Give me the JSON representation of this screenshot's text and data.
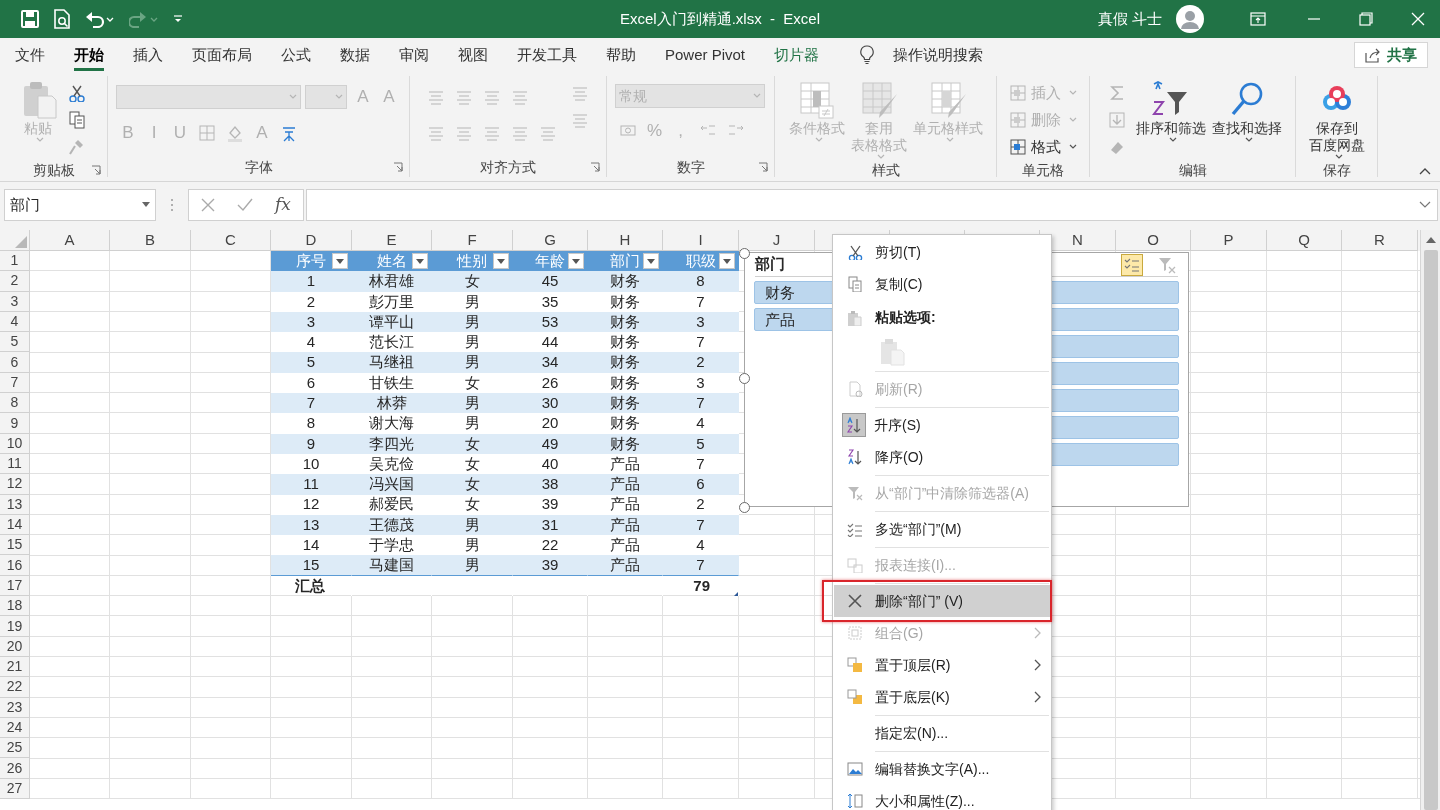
{
  "title_bar": {
    "title": "Excel入门到精通.xlsx  -  Excel",
    "user": "真假 斗士"
  },
  "tabs": [
    {
      "label": "文件",
      "selected": false
    },
    {
      "label": "开始",
      "selected": true
    },
    {
      "label": "插入",
      "selected": false
    },
    {
      "label": "页面布局",
      "selected": false
    },
    {
      "label": "公式",
      "selected": false
    },
    {
      "label": "数据",
      "selected": false
    },
    {
      "label": "审阅",
      "selected": false
    },
    {
      "label": "视图",
      "selected": false
    },
    {
      "label": "开发工具",
      "selected": false
    },
    {
      "label": "帮助",
      "selected": false
    },
    {
      "label": "Power Pivot",
      "selected": false
    }
  ],
  "contextual_tab": {
    "label": "切片器",
    "selected": false
  },
  "tell_me": {
    "placeholder": "操作说明搜索"
  },
  "share_button": {
    "label": "共享"
  },
  "ribbon": [
    {
      "label": "剪贴板",
      "launcher": true,
      "items": [
        {
          "kind": "large",
          "label": "粘贴",
          "disabled": true
        },
        {
          "kind": "stack",
          "items": [
            {
              "kind": "icon",
              "disabled": false
            },
            {
              "kind": "icon",
              "disabled": false
            },
            {
              "kind": "icon",
              "disabled": true
            }
          ]
        }
      ]
    },
    {
      "label": "字体",
      "launcher": true,
      "items": [
        {
          "kind": "grid",
          "rows": [
            [
              {
                "kind": "combo",
                "disabled": true
              },
              {
                "kind": "combo_small",
                "disabled": true
              },
              {
                "kind": "char",
                "label": "A",
                "disabled": true
              },
              {
                "kind": "char",
                "label": "A",
                "disabled": true
              }
            ],
            [
              {
                "kind": "char",
                "label": "B",
                "disabled": true
              },
              {
                "kind": "char",
                "label": "I",
                "disabled": true
              },
              {
                "kind": "char",
                "label": "U",
                "disabled": true
              },
              {
                "kind": "icon",
                "disabled": true
              },
              {
                "kind": "icon",
                "disabled": true
              },
              {
                "kind": "char",
                "label": "A",
                "disabled": true
              },
              {
                "kind": "icon",
                "disabled": false
              }
            ]
          ]
        }
      ]
    },
    {
      "label": "对齐方式",
      "launcher": true,
      "items": [
        {
          "kind": "grid",
          "rows": [
            [
              {
                "kind": "icon",
                "disabled": true
              },
              {
                "kind": "icon",
                "disabled": true
              },
              {
                "kind": "icon",
                "disabled": true
              },
              {
                "kind": "icon",
                "disabled": true
              }
            ],
            [
              {
                "kind": "icon",
                "disabled": true
              },
              {
                "kind": "icon",
                "disabled": true
              },
              {
                "kind": "icon",
                "disabled": true
              },
              {
                "kind": "icon",
                "disabled": true
              },
              {
                "kind": "icon",
                "disabled": true
              }
            ]
          ]
        },
        {
          "kind": "stack",
          "items": [
            {
              "kind": "icon",
              "disabled": true
            },
            {
              "kind": "icon",
              "disabled": true
            }
          ]
        }
      ]
    },
    {
      "label": "数字",
      "launcher": true,
      "items": [
        {
          "kind": "grid",
          "rows": [
            [
              {
                "kind": "combo",
                "value": "常规",
                "disabled": true
              }
            ],
            [
              {
                "kind": "icon",
                "disabled": true
              },
              {
                "kind": "char",
                "label": "%",
                "disabled": true
              },
              {
                "kind": "char",
                "label": ",",
                "disabled": true
              },
              {
                "kind": "icon",
                "disabled": true
              },
              {
                "kind": "icon",
                "disabled": true
              }
            ]
          ]
        }
      ]
    },
    {
      "label": "样式",
      "launcher": false,
      "items": [
        {
          "kind": "large",
          "label": "条件格式",
          "disabled": true
        },
        {
          "kind": "large",
          "lines": [
            "套用",
            "表格格式"
          ],
          "disabled": true
        },
        {
          "kind": "large",
          "label": "单元格样式",
          "disabled": true
        }
      ]
    },
    {
      "label": "单元格",
      "launcher": false,
      "items": [
        {
          "kind": "stack",
          "items": [
            {
              "kind": "small",
              "label": "插入",
              "disabled": true
            },
            {
              "kind": "small",
              "label": "删除",
              "disabled": true
            },
            {
              "kind": "small",
              "label": "格式",
              "disabled": false
            }
          ]
        }
      ]
    },
    {
      "label": "编辑",
      "launcher": false,
      "items": [
        {
          "kind": "stack",
          "items": [
            {
              "kind": "icon",
              "disabled": true
            },
            {
              "kind": "icon",
              "disabled": true
            },
            {
              "kind": "icon",
              "disabled": true
            }
          ]
        },
        {
          "kind": "large",
          "label": "排序和筛选",
          "disabled": false
        },
        {
          "kind": "large",
          "label": "查找和选择",
          "disabled": false
        }
      ]
    },
    {
      "label": "保存",
      "launcher": false,
      "items": [
        {
          "kind": "large",
          "lines": [
            "保存到",
            "百度网盘"
          ],
          "disabled": false
        }
      ]
    }
  ],
  "formula_bar": {
    "name_box": "部门",
    "function_label": "fx"
  },
  "column_headers": [
    "A",
    "B",
    "C",
    "D",
    "E",
    "F",
    "G",
    "H",
    "I",
    "J",
    "N",
    "O",
    "P",
    "Q",
    "R"
  ],
  "row_headers": [
    "1",
    "2",
    "3",
    "4",
    "5",
    "6",
    "7",
    "8",
    "9",
    "10",
    "11",
    "12",
    "13",
    "14",
    "15",
    "16",
    "17",
    "18",
    "19",
    "20",
    "21",
    "22",
    "23",
    "24",
    "25",
    "26",
    "27"
  ],
  "table": {
    "columns": [
      "序号",
      "姓名",
      "性别",
      "年龄",
      "部门",
      "职级"
    ],
    "rows": [
      [
        "1",
        "林君雄",
        "女",
        "45",
        "财务",
        "8"
      ],
      [
        "2",
        "彭万里",
        "男",
        "35",
        "财务",
        "7"
      ],
      [
        "3",
        "谭平山",
        "男",
        "53",
        "财务",
        "3"
      ],
      [
        "4",
        "范长江",
        "男",
        "44",
        "财务",
        "7"
      ],
      [
        "5",
        "马继祖",
        "男",
        "34",
        "财务",
        "2"
      ],
      [
        "6",
        "甘铁生",
        "女",
        "26",
        "财务",
        "3"
      ],
      [
        "7",
        "林莽",
        "男",
        "30",
        "财务",
        "7"
      ],
      [
        "8",
        "谢大海",
        "男",
        "20",
        "财务",
        "4"
      ],
      [
        "9",
        "李四光",
        "女",
        "49",
        "财务",
        "5"
      ],
      [
        "10",
        "吴克俭",
        "女",
        "40",
        "产品",
        "7"
      ],
      [
        "11",
        "冯兴国",
        "女",
        "38",
        "产品",
        "6"
      ],
      [
        "12",
        "郝爱民",
        "女",
        "39",
        "产品",
        "2"
      ],
      [
        "13",
        "王德茂",
        "男",
        "31",
        "产品",
        "7"
      ],
      [
        "14",
        "于学忠",
        "男",
        "22",
        "产品",
        "4"
      ],
      [
        "15",
        "马建国",
        "男",
        "39",
        "产品",
        "7"
      ]
    ],
    "total": {
      "label": "汇总",
      "value": "79"
    }
  },
  "slicer": {
    "title": "部门",
    "multi_select": true,
    "items": [
      {
        "label": "财务",
        "selected": true
      },
      {
        "label": "产品",
        "selected": true
      },
      {
        "selected": true
      },
      {
        "selected": true
      },
      {
        "selected": true
      },
      {
        "selected": true
      },
      {
        "selected": true
      }
    ]
  },
  "context_menu": [
    {
      "kind": "item",
      "label": "剪切(T)",
      "disabled": false,
      "checked": false,
      "highlighted": false,
      "submenu": false,
      "annotated": false
    },
    {
      "kind": "item",
      "label": "复制(C)",
      "disabled": false,
      "checked": false,
      "highlighted": false,
      "submenu": false,
      "annotated": false
    },
    {
      "kind": "header",
      "label": "粘贴选项:"
    },
    {
      "kind": "paste_options",
      "disabled": true
    },
    {
      "kind": "separator"
    },
    {
      "kind": "item",
      "label": "刷新(R)",
      "disabled": true,
      "checked": false,
      "highlighted": false,
      "submenu": false,
      "annotated": false
    },
    {
      "kind": "separator"
    },
    {
      "kind": "item",
      "label": "升序(S)",
      "disabled": false,
      "checked": true,
      "highlighted": false,
      "submenu": false,
      "annotated": false
    },
    {
      "kind": "item",
      "label": "降序(O)",
      "disabled": false,
      "checked": false,
      "highlighted": false,
      "submenu": false,
      "annotated": false
    },
    {
      "kind": "separator"
    },
    {
      "kind": "item",
      "label": "从“部门”中清除筛选器(A)",
      "disabled": true,
      "checked": false,
      "highlighted": false,
      "submenu": false,
      "annotated": false
    },
    {
      "kind": "separator"
    },
    {
      "kind": "item",
      "label": "多选“部门”(M)",
      "disabled": false,
      "checked": false,
      "highlighted": false,
      "submenu": false,
      "annotated": false
    },
    {
      "kind": "separator"
    },
    {
      "kind": "item",
      "label": "报表连接(I)...",
      "disabled": true,
      "checked": false,
      "highlighted": false,
      "submenu": false,
      "annotated": false
    },
    {
      "kind": "separator"
    },
    {
      "kind": "item",
      "label": "删除“部门” (V)",
      "disabled": false,
      "checked": false,
      "highlighted": true,
      "submenu": false,
      "annotated": true
    },
    {
      "kind": "item",
      "label": "组合(G)",
      "disabled": true,
      "checked": false,
      "highlighted": false,
      "submenu": true,
      "annotated": false
    },
    {
      "kind": "item",
      "label": "置于顶层(R)",
      "disabled": false,
      "checked": false,
      "highlighted": false,
      "submenu": true,
      "annotated": false
    },
    {
      "kind": "item",
      "label": "置于底层(K)",
      "disabled": false,
      "checked": false,
      "highlighted": false,
      "submenu": true,
      "annotated": false
    },
    {
      "kind": "separator"
    },
    {
      "kind": "item",
      "label": "指定宏(N)...",
      "disabled": false,
      "checked": false,
      "highlighted": false,
      "submenu": false,
      "annotated": false
    },
    {
      "kind": "separator"
    },
    {
      "kind": "item",
      "label": "编辑替换文字(A)...",
      "disabled": false,
      "checked": false,
      "highlighted": false,
      "submenu": false,
      "annotated": false
    },
    {
      "kind": "item",
      "label": "大小和属性(Z)...",
      "disabled": false,
      "checked": false,
      "highlighted": false,
      "submenu": false,
      "annotated": false
    }
  ]
}
